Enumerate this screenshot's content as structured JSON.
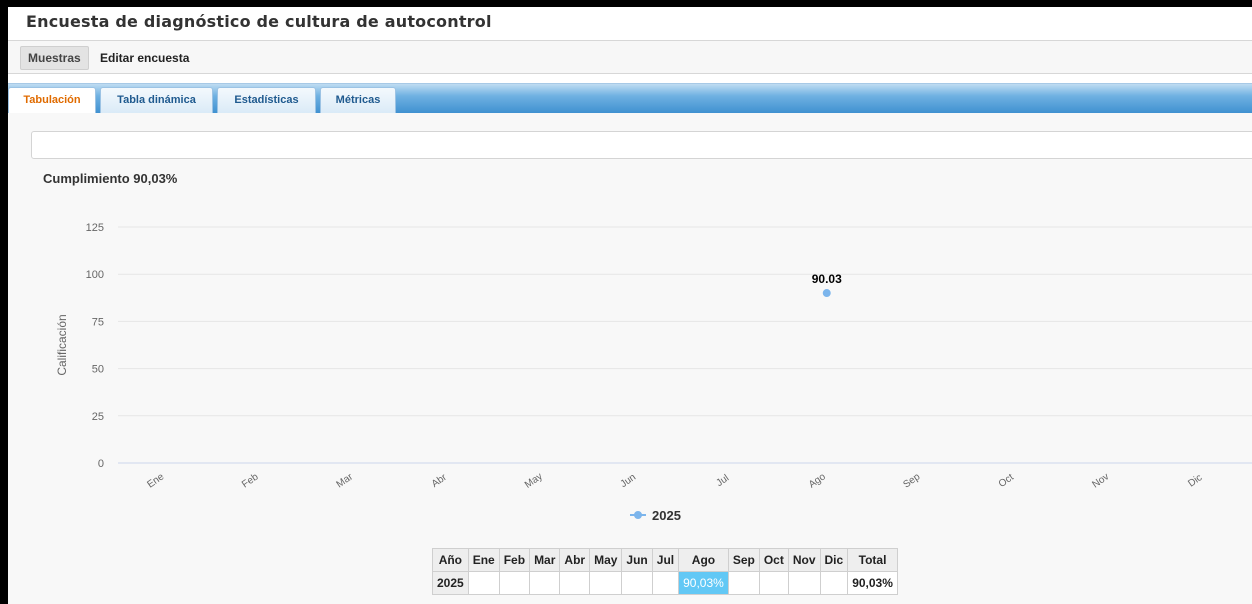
{
  "page": {
    "title": "Encuesta de diagnóstico de cultura de autocontrol"
  },
  "menu": {
    "samples_label": "Muestras",
    "edit_label": "Editar encuesta"
  },
  "tabs": [
    {
      "label": "Tabulación",
      "active": true
    },
    {
      "label": "Tabla dinámica",
      "active": false
    },
    {
      "label": "Estadísticas",
      "active": false
    },
    {
      "label": "Métricas",
      "active": false
    }
  ],
  "colors": {
    "accent": "#e06b00",
    "series": "#7cb5ec",
    "highlight": "#62c8f5",
    "tab_strip": "#3d8fd0"
  },
  "chart_data": {
    "type": "line",
    "title": "Cumplimiento 90,03%",
    "ylabel": "Calificación",
    "xlabel": "",
    "ylim": [
      0,
      125
    ],
    "yticks": [
      0,
      25,
      50,
      75,
      100,
      125
    ],
    "categories": [
      "Ene",
      "Feb",
      "Mar",
      "Abr",
      "May",
      "Jun",
      "Jul",
      "Ago",
      "Sep",
      "Oct",
      "Nov",
      "Dic"
    ],
    "series": [
      {
        "name": "2025",
        "values": [
          null,
          null,
          null,
          null,
          null,
          null,
          null,
          90.03,
          null,
          null,
          null,
          null
        ]
      }
    ],
    "data_labels": [
      "90.03"
    ],
    "grid": true,
    "legend": "bottom-center"
  },
  "table": {
    "headers": [
      "Año",
      "Ene",
      "Feb",
      "Mar",
      "Abr",
      "May",
      "Jun",
      "Jul",
      "Ago",
      "Sep",
      "Oct",
      "Nov",
      "Dic",
      "Total"
    ],
    "rows": [
      {
        "year": "2025",
        "cells": [
          "",
          "",
          "",
          "",
          "",
          "",
          "",
          "90,03%",
          "",
          "",
          "",
          ""
        ],
        "total": "90,03%"
      }
    ]
  }
}
